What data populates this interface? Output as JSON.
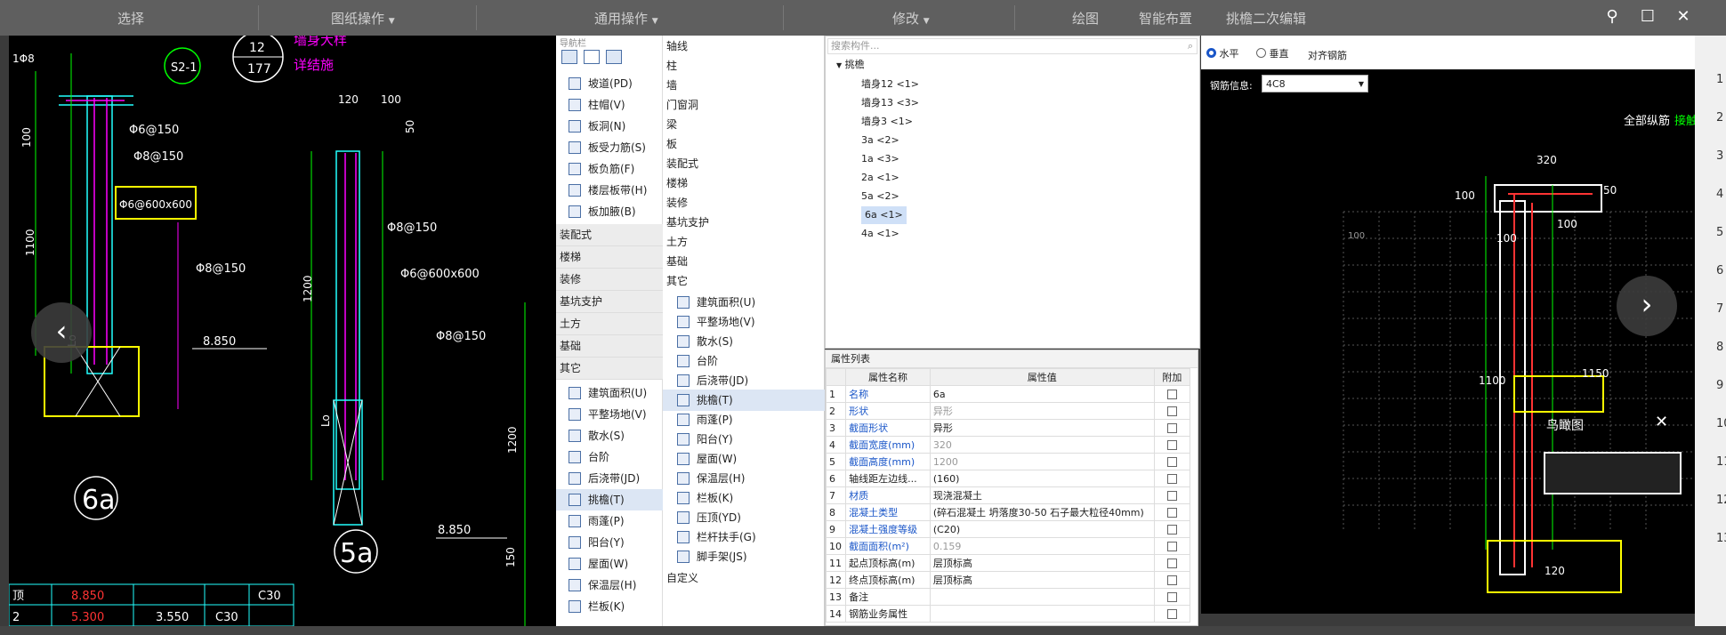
{
  "ribbon": {
    "groups": [
      "选择",
      "图纸操作",
      "通用操作",
      "修改",
      "绘图",
      "智能布置",
      "挑檐二次编辑"
    ]
  },
  "window": {
    "pin": "⚲",
    "maximize": "☐",
    "close": "✕"
  },
  "left_drawing": {
    "labels": {
      "rebar_top_a": "1Φ8",
      "dim_100": "100",
      "dim_1100": "1100",
      "phi6_150": "Φ6@150",
      "phi8_150": "Φ8@150",
      "phi6_600_box": "Φ6@600x600",
      "phi8_150_b": "Φ8@150",
      "elev_8850": "8.850",
      "circle_6a": "6a",
      "detail_12": "12",
      "detail_177": "177",
      "detail_s21": "S2-1",
      "wall_detail": "墙身大样",
      "wall_detail_2": "详结施",
      "dim_120": "120",
      "dim_100b": "100",
      "dim_1200": "1200",
      "phi8_150_c": "Φ8@150",
      "phi6_600_b": "Φ6@600x600",
      "phi8_150_d": "Φ8@150",
      "elev_8850b": "8.850",
      "circle_5a": "5a",
      "dim_1200b": "1200",
      "dim_150": "150",
      "lo_a": "Lo",
      "lo_b": "Lo",
      "dim_50": "50"
    },
    "table_rows": [
      {
        "c1": "顶",
        "c2": "8.850",
        "c3": "",
        "c4": "C30"
      },
      {
        "c1": "2",
        "c2": "5.300",
        "c3": "3.550",
        "c4": "C30"
      }
    ]
  },
  "nav1": {
    "header": "导航栏",
    "items": [
      "坡道(PD)",
      "柱帽(V)",
      "板洞(N)",
      "板受力筋(S)",
      "板负筋(F)",
      "楼层板带(H)",
      "板加腋(B)"
    ],
    "cats": [
      "装配式",
      "楼梯",
      "装修",
      "基坑支护",
      "土方",
      "基础",
      "其它"
    ],
    "other_items": [
      "建筑面积(U)",
      "平整场地(V)",
      "散水(S)",
      "台阶",
      "后浇带(JD)",
      "挑檐(T)",
      "雨蓬(P)",
      "阳台(Y)",
      "屋面(W)",
      "保温层(H)",
      "栏板(K)"
    ]
  },
  "nav2": {
    "cats": [
      "轴线",
      "柱",
      "墙",
      "门窗洞",
      "梁",
      "板",
      "装配式",
      "楼梯",
      "装修",
      "基坑支护",
      "土方",
      "基础",
      "其它"
    ],
    "other_items": [
      "建筑面积(U)",
      "平整场地(V)",
      "散水(S)",
      "台阶",
      "后浇带(JD)",
      "挑檐(T)",
      "雨蓬(P)",
      "阳台(Y)",
      "屋面(W)",
      "保温层(H)",
      "栏板(K)",
      "压顶(YD)",
      "栏杆扶手(G)",
      "脚手架(JS)"
    ],
    "last": "自定义"
  },
  "component_list": {
    "placeholder": "搜索构件...",
    "root": "挑檐",
    "items": [
      "墙身12 <1>",
      "墙身13 <3>",
      "墙身3 <1>",
      "3a <2>",
      "1a <3>",
      "2a <1>",
      "5a <2>",
      "6a <1>",
      "4a <1>"
    ]
  },
  "props": {
    "title": "属性列表",
    "headers": [
      "属性名称",
      "属性值",
      "附加"
    ],
    "rows": [
      {
        "n": "1",
        "name": "名称",
        "val": "6a",
        "blue": true,
        "grey": false
      },
      {
        "n": "2",
        "name": "形状",
        "val": "异形",
        "blue": true,
        "grey": true
      },
      {
        "n": "3",
        "name": "截面形状",
        "val": "异形",
        "blue": true,
        "grey": false
      },
      {
        "n": "4",
        "name": "截面宽度(mm)",
        "val": "320",
        "blue": true,
        "grey": true
      },
      {
        "n": "5",
        "name": "截面高度(mm)",
        "val": "1200",
        "blue": true,
        "grey": true
      },
      {
        "n": "6",
        "name": "轴线距左边线...",
        "val": "(160)",
        "blue": false,
        "grey": false
      },
      {
        "n": "7",
        "name": "材质",
        "val": "现浇混凝土",
        "blue": true,
        "grey": false
      },
      {
        "n": "8",
        "name": "混凝土类型",
        "val": "(碎石混凝土 坍落度30-50 石子最大粒径40mm)",
        "blue": true,
        "grey": false
      },
      {
        "n": "9",
        "name": "混凝土强度等级",
        "val": "(C20)",
        "blue": true,
        "grey": false
      },
      {
        "n": "10",
        "name": "截面面积(m²)",
        "val": "0.159",
        "blue": true,
        "grey": true
      },
      {
        "n": "11",
        "name": "起点顶标高(m)",
        "val": "层顶标高",
        "blue": false,
        "grey": false
      },
      {
        "n": "12",
        "name": "终点顶标高(m)",
        "val": "层顶标高",
        "blue": false,
        "grey": false
      },
      {
        "n": "13",
        "name": "备注",
        "val": "",
        "blue": false,
        "grey": false
      },
      {
        "n": "14",
        "name": "钢筋业务属性",
        "val": "",
        "blue": false,
        "grey": false
      }
    ]
  },
  "right_panel": {
    "radio_h": "水平",
    "radio_v": "垂直",
    "align": "对齐钢筋",
    "rebar_info_label": "钢筋信息:",
    "rebar_info_value": "4C8",
    "all_rebar": "全部纵筋",
    "rebar_connect": "接触",
    "dims": {
      "d320": "320",
      "d100a": "100",
      "d50": "50",
      "d100b": "100",
      "d100c": "100",
      "d1100": "1100",
      "d1150": "1150",
      "d120": "120"
    },
    "birdseye": "鸟瞰图",
    "grid_label": "100"
  },
  "right_edge_chars": [
    "1",
    "2",
    "3",
    "4",
    "5",
    "6",
    "7",
    "8",
    "9",
    "10",
    "11",
    "12",
    "13"
  ]
}
